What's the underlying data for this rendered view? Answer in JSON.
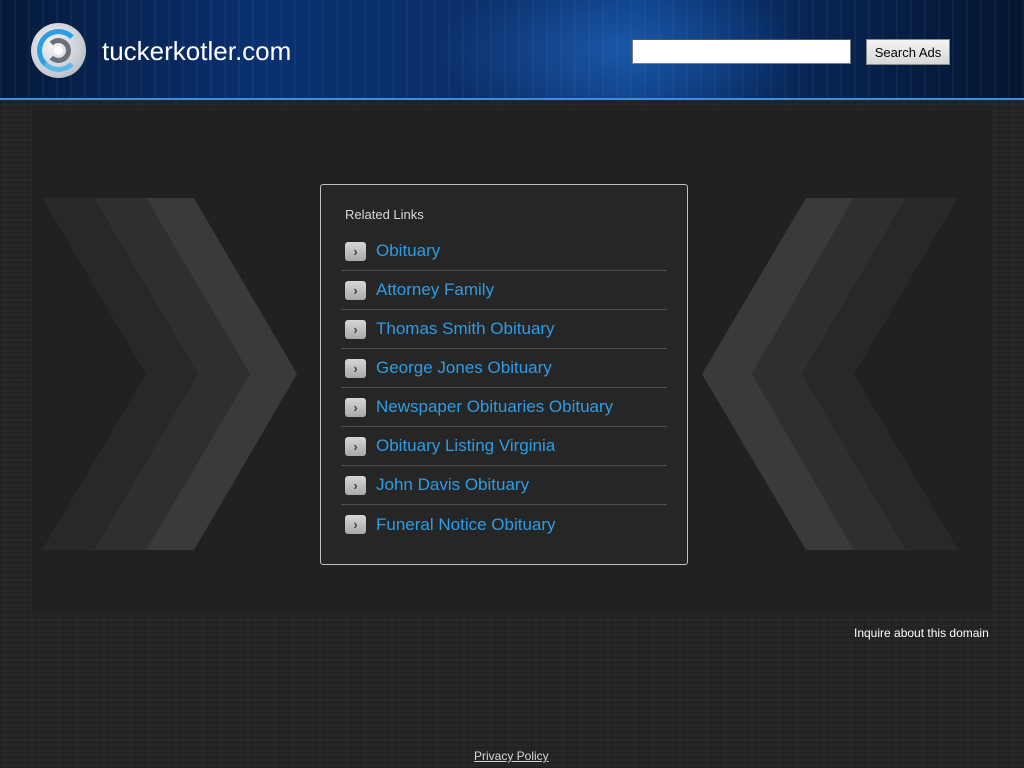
{
  "header": {
    "site_title": "tuckerkotler.com",
    "search_placeholder": "",
    "search_button_label": "Search Ads",
    "accent_color": "#3e8ee0"
  },
  "related_links": {
    "heading": "Related Links",
    "items": [
      {
        "label": "Obituary",
        "icon": "chevron-right-icon"
      },
      {
        "label": "Attorney Family",
        "icon": "chevron-right-icon"
      },
      {
        "label": "Thomas Smith Obituary",
        "icon": "chevron-right-icon"
      },
      {
        "label": "George Jones Obituary",
        "icon": "chevron-right-icon"
      },
      {
        "label": "Newspaper Obituaries Obituary",
        "icon": "chevron-right-icon"
      },
      {
        "label": "Obituary Listing Virginia",
        "icon": "chevron-right-icon"
      },
      {
        "label": "John Davis Obituary",
        "icon": "chevron-right-icon"
      },
      {
        "label": "Funeral Notice Obituary",
        "icon": "chevron-right-icon"
      }
    ],
    "link_color": "#2d9ce6"
  },
  "footer": {
    "inquire_label": "Inquire about this domain",
    "privacy_label": "Privacy Policy"
  }
}
